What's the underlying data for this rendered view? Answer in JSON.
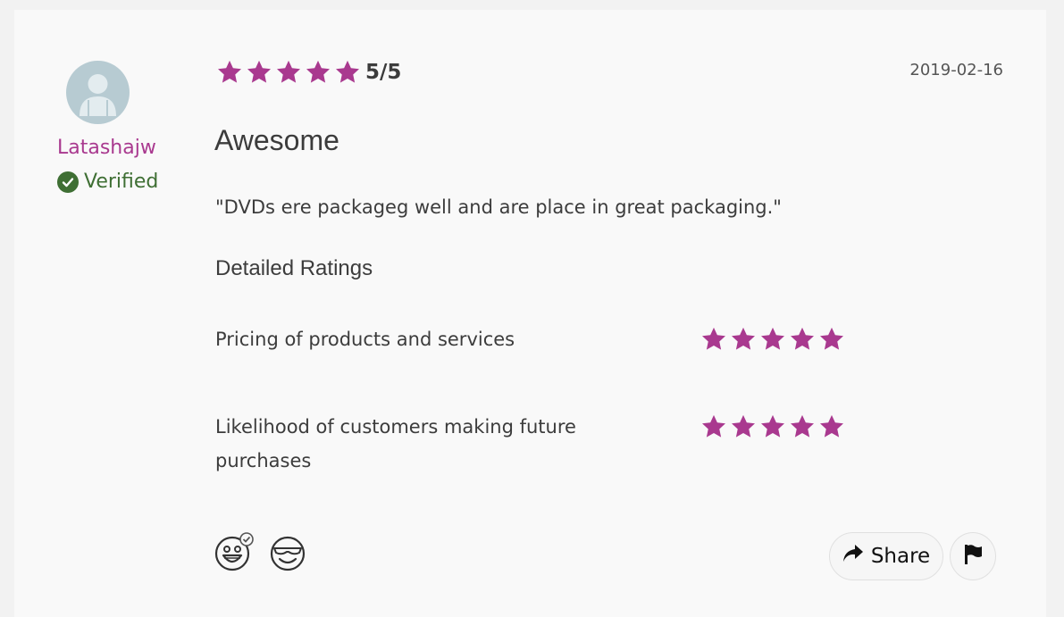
{
  "review": {
    "username": "Latashajw",
    "verified_label": "Verified",
    "overall_rating": 5,
    "overall_max": 5,
    "rating_text": "5/5",
    "date": "2019-02-16",
    "title": "Awesome",
    "body": "\"DVDs ere packageg well and are place in great packaging.\""
  },
  "detailed": {
    "heading": "Detailed Ratings",
    "criteria": [
      {
        "label": "Pricing of products and services",
        "rating": 5,
        "max": 5
      },
      {
        "label": "Likelihood of customers making future purchases",
        "rating": 5,
        "max": 5
      }
    ]
  },
  "actions": {
    "share_label": "Share",
    "reactions": [
      "verified-grin-icon",
      "cool-smile-icon"
    ]
  },
  "colors": {
    "accent": "#a9398f",
    "verified": "#3f6f34",
    "avatar_bg": "#b7cbd2"
  }
}
